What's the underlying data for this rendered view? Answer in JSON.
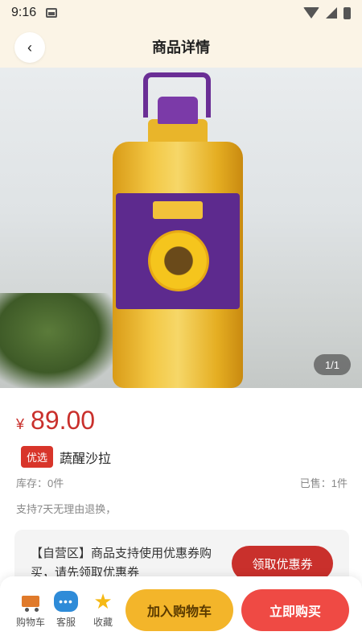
{
  "status_bar": {
    "time": "9:16"
  },
  "header": {
    "back_icon": "‹",
    "title": "商品详情"
  },
  "gallery": {
    "image_counter": "1/1"
  },
  "product": {
    "currency": "¥",
    "price": "89.00",
    "badge": "优选",
    "name": "蔬醒沙拉",
    "stock": "库存：0件",
    "sold": "已售：1件",
    "policy": "支持7天无理由退换，"
  },
  "coupon": {
    "text": "【自营区】商品支持使用优惠券购买，请先领取优惠券",
    "button": "领取优惠券"
  },
  "bottom_bar": {
    "cart_label": "购物车",
    "service_label": "客服",
    "favorite_label": "收藏",
    "add_to_cart": "加入购物车",
    "buy_now": "立即购买"
  },
  "colors": {
    "accent_red": "#c9302c",
    "add_cart_yellow": "#f3b52a",
    "buy_now_red": "#ef4a44",
    "header_bg": "#fbf4e6"
  }
}
